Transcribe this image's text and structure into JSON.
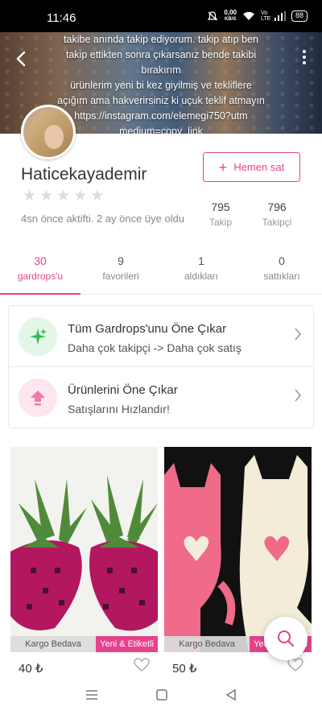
{
  "status_bar": {
    "time": "11:46",
    "speed_value": "0,00",
    "speed_unit": "KB/S",
    "network": "Vo LTE",
    "battery": "88"
  },
  "cover": {
    "bio_lines": [
      "takibe anında takip ediyorum. takip atıp ben",
      "takip ettikten sonra çıkarsanız bende takibi",
      "bırakırım",
      "ürünlerim yeni bi kez giyilmiş ve tekliflere",
      "açığım ama hakverirsiniz ki uçuk teklif atmayın",
      "https://instagram.com/elemegi750?utm",
      "medium=copy_link"
    ]
  },
  "profile": {
    "username": "Haticekayademir",
    "rating_stars": 0,
    "activity": "4sn önce aktifti. 2 ay önce üye oldu",
    "sell_button": "Hemen sat",
    "following_count": "795",
    "following_label": "Takip",
    "followers_count": "796",
    "followers_label": "Takipçi"
  },
  "tabs": [
    {
      "count": "30",
      "label": "gardrops'u"
    },
    {
      "count": "9",
      "label": "favorileri"
    },
    {
      "count": "1",
      "label": "aldıkları"
    },
    {
      "count": "0",
      "label": "sattıkları"
    }
  ],
  "promos": [
    {
      "title": "Tüm Gardrops'unu Öne Çıkar",
      "subtitle": "Daha çok takipçi -> Daha çok satış",
      "icon": "sparkle-icon",
      "color": "#2ebd59"
    },
    {
      "title": "Ürünlerini Öne Çıkar",
      "subtitle": "Satışlarını Hızlandır!",
      "icon": "arrow-up-icon",
      "color": "#e6428c"
    }
  ],
  "products": [
    {
      "price": "40 ₺",
      "cargo_tag": "Kargo Bedava",
      "new_tag": "Yeni & Etiketli"
    },
    {
      "price": "50 ₺",
      "cargo_tag": "Kargo Bedava",
      "new_tag": "Yeni & Etiketli"
    }
  ],
  "colors": {
    "accent": "#e6428c",
    "success": "#2ebd59"
  }
}
